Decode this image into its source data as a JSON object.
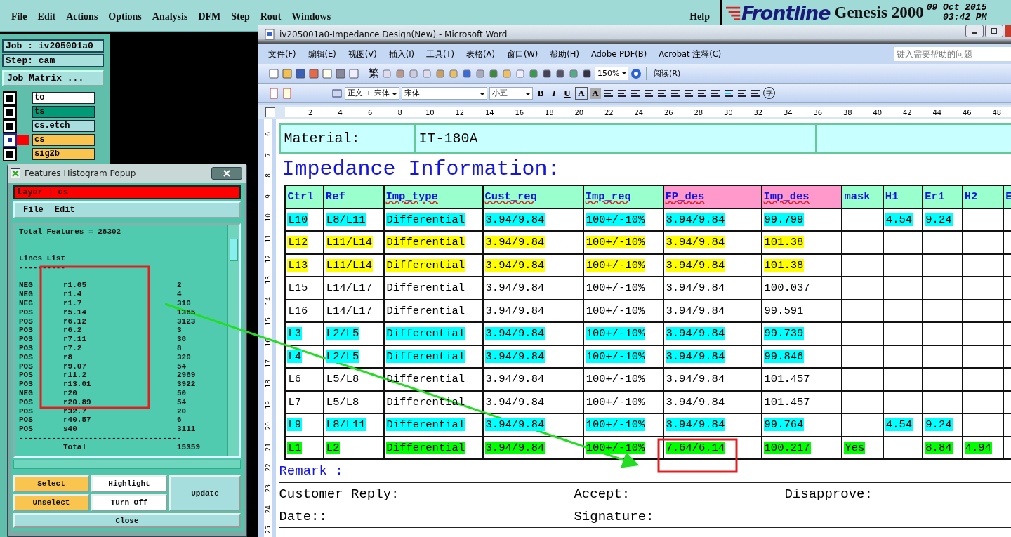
{
  "genesis": {
    "menu": [
      "File",
      "Edit",
      "Actions",
      "Options",
      "Analysis",
      "DFM",
      "Step",
      "Rout",
      "Windows"
    ],
    "help": "Help",
    "logo": "Frontline",
    "product": "Genesis 2000",
    "date": "09 Oct 2015",
    "time": "03:42 PM",
    "job": "Job : iv205001a0",
    "step": "Step: cam",
    "job_matrix": "Job Matrix ...",
    "layers": [
      {
        "name": "to",
        "color": "#ffffff",
        "selected": false
      },
      {
        "name": "ts",
        "color": "#009a77",
        "selected": false
      },
      {
        "name": "cs.etch",
        "color": "#a8dede",
        "selected": false
      },
      {
        "name": "cs",
        "color": "#f9c54f",
        "selected": true
      },
      {
        "name": "sig2b",
        "color": "#f9c54f",
        "selected": false
      }
    ]
  },
  "histogram": {
    "title": "Features Histogram Popup",
    "layer": "Layer :  cs",
    "menu": [
      "File",
      "Edit"
    ],
    "total_features": "Total Features = 28302",
    "list_title": "Lines List",
    "list_rule": "----------",
    "rows": [
      [
        "NEG",
        "r1.05",
        "2"
      ],
      [
        "NEG",
        "r1.4",
        "4"
      ],
      [
        "NEG",
        "r1.7",
        "310"
      ],
      [
        "POS",
        "r5.14",
        "1365"
      ],
      [
        "POS",
        "r6.12",
        "3123"
      ],
      [
        "POS",
        "r6.2",
        "3"
      ],
      [
        "POS",
        "r7.11",
        "38"
      ],
      [
        "POS",
        "r7.2",
        "8"
      ],
      [
        "POS",
        "r8",
        "320"
      ],
      [
        "POS",
        "r9.07",
        "54"
      ],
      [
        "POS",
        "r11.2",
        "2969"
      ],
      [
        "POS",
        "r13.01",
        "3922"
      ],
      [
        "NEG",
        "r20",
        "50"
      ],
      [
        "POS",
        "r20.89",
        "54"
      ],
      [
        "POS",
        "r32.7",
        "20"
      ],
      [
        "POS",
        "r40.57",
        "6"
      ],
      [
        "POS",
        "s40",
        "3111"
      ]
    ],
    "total_rule": "-----------------------------------",
    "total_label": "Total",
    "total": "15359",
    "buttons": [
      {
        "label": "Select",
        "kind": "orange"
      },
      {
        "label": "Highlight",
        "kind": "white"
      },
      {
        "label": "Update",
        "kind": "tall"
      },
      {
        "label": "Unselect",
        "kind": "orange"
      },
      {
        "label": "Turn Off",
        "kind": "white"
      }
    ],
    "close": "Close"
  },
  "word": {
    "title": "iv205001a0-Impedance Design(New) - Microsoft Word",
    "menu": [
      "文件(F)",
      "编辑(E)",
      "视图(V)",
      "插入(I)",
      "工具(T)",
      "表格(A)",
      "窗口(W)",
      "帮助(H)",
      "Adobe PDF(B)",
      "Acrobat 注释(C)"
    ],
    "help_placeholder": "键入需要帮助的问题",
    "traditional": "繁",
    "zoom": "150%",
    "read": "阅读(R)",
    "style": "正文 + 宋体",
    "font": "宋体",
    "size": "小五",
    "format": [
      "B",
      "I",
      "U",
      "A",
      "A"
    ],
    "enclose": "字",
    "ruler": [
      "2",
      "4",
      "6",
      "8",
      "10",
      "12",
      "14",
      "16",
      "18",
      "20",
      "22",
      "24",
      "26",
      "28",
      "30",
      "32",
      "34",
      "36",
      "38",
      "40",
      "42",
      "44",
      "46",
      "48"
    ],
    "vruler": [
      "6",
      "7",
      "8",
      "9",
      "10",
      "11",
      "12",
      "13",
      "14",
      "15",
      "16",
      "17",
      "18",
      "19",
      "20",
      "21",
      "22",
      "23",
      "24",
      "25"
    ],
    "material_label": "Material:",
    "material_value": "IT-180A",
    "heading": "Impedance Information:",
    "columns": [
      {
        "label": "Ctrl",
        "color": "#99ffcc",
        "misspelled": false
      },
      {
        "label": "Ref",
        "color": "#99ffcc",
        "misspelled": false
      },
      {
        "label": "Imp_type",
        "color": "#99ffcc",
        "misspelled": true
      },
      {
        "label": "Cust_req",
        "color": "#99ffcc",
        "misspelled": true
      },
      {
        "label": "Imp_req",
        "color": "#99ffcc",
        "misspelled": true
      },
      {
        "label": "FP_des",
        "color": "#ff99cc",
        "misspelled": true
      },
      {
        "label": "Imp_des",
        "color": "#ff99cc",
        "misspelled": true
      },
      {
        "label": "mask",
        "color": "#99ffcc",
        "misspelled": false
      },
      {
        "label": "H1",
        "color": "#99ffcc",
        "misspelled": false
      },
      {
        "label": "Er1",
        "color": "#99ffcc",
        "misspelled": false
      },
      {
        "label": "H2",
        "color": "#99ffcc",
        "misspelled": false
      },
      {
        "label": "E",
        "color": "#99ffcc",
        "misspelled": false
      }
    ],
    "rows": [
      [
        {
          "text": "L10",
          "color": "#00ffff"
        },
        {
          "text": "L8/L11",
          "color": "#00ffff"
        },
        {
          "text": "Differential",
          "color": "#00ffff"
        },
        {
          "text": "3.94/9.84",
          "color": "#00ffff"
        },
        {
          "text": "100+/-10%",
          "color": "#00ffff"
        },
        {
          "text": "3.94/9.84",
          "color": "#00ffff"
        },
        {
          "text": "99.799",
          "color": "#00ffff"
        },
        null,
        {
          "text": "4.54",
          "color": "#00ffff"
        },
        {
          "text": "9.24",
          "color": "#00ffff"
        },
        null,
        null
      ],
      [
        {
          "text": "L12",
          "color": "#ffff00"
        },
        {
          "text": "L11/L14",
          "color": "#ffff00"
        },
        {
          "text": "Differential",
          "color": "#ffff00"
        },
        {
          "text": "3.94/9.84",
          "color": "#ffff00"
        },
        {
          "text": "100+/-10%",
          "color": "#ffff00"
        },
        {
          "text": "3.94/9.84",
          "color": "#ffff00"
        },
        {
          "text": "101.38",
          "color": "#ffff00"
        },
        null,
        null,
        null,
        null,
        null
      ],
      [
        {
          "text": "L13",
          "color": "#ffff00"
        },
        {
          "text": "L11/L14",
          "color": "#ffff00"
        },
        {
          "text": "Differential",
          "color": "#ffff00"
        },
        {
          "text": "3.94/9.84",
          "color": "#ffff00"
        },
        {
          "text": "100+/-10%",
          "color": "#ffff00"
        },
        {
          "text": "3.94/9.84",
          "color": "#ffff00"
        },
        {
          "text": "101.38",
          "color": "#ffff00"
        },
        null,
        null,
        null,
        null,
        null
      ],
      [
        {
          "text": "L15"
        },
        {
          "text": "L14/L17"
        },
        {
          "text": "Differential"
        },
        {
          "text": "3.94/9.84"
        },
        {
          "text": "100+/-10%"
        },
        {
          "text": "3.94/9.84"
        },
        {
          "text": "100.037"
        },
        null,
        null,
        null,
        null,
        null
      ],
      [
        {
          "text": "L16"
        },
        {
          "text": "L14/L17"
        },
        {
          "text": "Differential"
        },
        {
          "text": "3.94/9.84"
        },
        {
          "text": "100+/-10%"
        },
        {
          "text": "3.94/9.84"
        },
        {
          "text": "99.591"
        },
        null,
        null,
        null,
        null,
        null
      ],
      [
        {
          "text": "L3",
          "color": "#00ffff"
        },
        {
          "text": "L2/L5",
          "color": "#00ffff"
        },
        {
          "text": "Differential",
          "color": "#00ffff"
        },
        {
          "text": "3.94/9.84",
          "color": "#00ffff"
        },
        {
          "text": "100+/-10%",
          "color": "#00ffff"
        },
        {
          "text": "3.94/9.84",
          "color": "#00ffff"
        },
        {
          "text": "99.739",
          "color": "#00ffff"
        },
        null,
        null,
        null,
        null,
        null
      ],
      [
        {
          "text": "L4",
          "color": "#00ffff"
        },
        {
          "text": "L2/L5",
          "color": "#00ffff"
        },
        {
          "text": "Differential",
          "color": "#00ffff"
        },
        {
          "text": "3.94/9.84",
          "color": "#00ffff"
        },
        {
          "text": "100+/-10%",
          "color": "#00ffff"
        },
        {
          "text": "3.94/9.84",
          "color": "#00ffff"
        },
        {
          "text": "99.846",
          "color": "#00ffff"
        },
        null,
        null,
        null,
        null,
        null
      ],
      [
        {
          "text": "L6"
        },
        {
          "text": "L5/L8"
        },
        {
          "text": "Differential"
        },
        {
          "text": "3.94/9.84"
        },
        {
          "text": "100+/-10%"
        },
        {
          "text": "3.94/9.84"
        },
        {
          "text": "101.457"
        },
        null,
        null,
        null,
        null,
        null
      ],
      [
        {
          "text": "L7"
        },
        {
          "text": "L5/L8"
        },
        {
          "text": "Differential"
        },
        {
          "text": "3.94/9.84"
        },
        {
          "text": "100+/-10%"
        },
        {
          "text": "3.94/9.84"
        },
        {
          "text": "101.457"
        },
        null,
        null,
        null,
        null,
        null
      ],
      [
        {
          "text": "L9",
          "color": "#00ffff"
        },
        {
          "text": "L8/L11",
          "color": "#00ffff"
        },
        {
          "text": "Differential",
          "color": "#00ffff"
        },
        {
          "text": "3.94/9.84",
          "color": "#00ffff"
        },
        {
          "text": "100+/-10%",
          "color": "#00ffff"
        },
        {
          "text": "3.94/9.84",
          "color": "#00ffff"
        },
        {
          "text": "99.764",
          "color": "#00ffff"
        },
        null,
        {
          "text": "4.54",
          "color": "#00ffff"
        },
        {
          "text": "9.24",
          "color": "#00ffff"
        },
        null,
        null
      ],
      [
        {
          "text": "L1",
          "color": "#00ff00"
        },
        {
          "text": "L2",
          "color": "#00ff00"
        },
        {
          "text": "Differential",
          "color": "#00ff00"
        },
        {
          "text": "3.94/9.84",
          "color": "#00ff00"
        },
        {
          "text": "100+/-10%",
          "color": "#00ff00"
        },
        {
          "text": "7.64/6.14",
          "color": "#00ff00"
        },
        {
          "text": "100.217",
          "color": "#00ff00"
        },
        {
          "text": "Yes",
          "color": "#00ff00"
        },
        null,
        {
          "text": "8.84",
          "color": "#00ff00"
        },
        {
          "text": "4.94",
          "color": "#00ff00"
        },
        null
      ]
    ],
    "remark": "Remark :",
    "customer_reply": "Customer Reply:",
    "accept": "Accept:",
    "disapprove": "Disapprove:",
    "date": "Date::",
    "signature": "Signature:"
  }
}
